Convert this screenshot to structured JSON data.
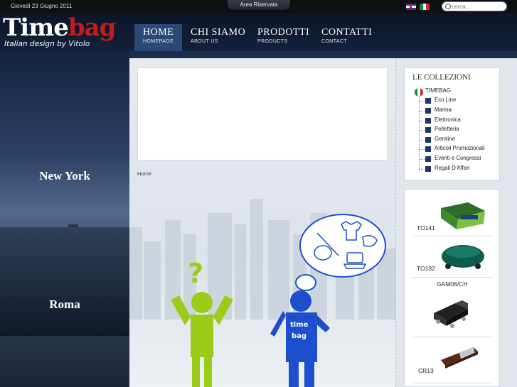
{
  "topbar": {
    "date": "Giovedì 23 Giugno 2011",
    "area_label": "Area Riservata",
    "search_placeholder": "cerca..."
  },
  "logo": {
    "brand_part1": "Time",
    "brand_part2": "bag",
    "tagline": "Italian design by Vitolo"
  },
  "nav": [
    {
      "label": "HOME",
      "sub": "HOMEPAGE",
      "active": true
    },
    {
      "label": "CHI SIAMO",
      "sub": "ABOUT US",
      "active": false
    },
    {
      "label": "PRODOTTI",
      "sub": "PRODUCTS",
      "active": false
    },
    {
      "label": "CONTATTI",
      "sub": "CONTACT",
      "active": false
    }
  ],
  "cities": {
    "top": "New York",
    "bottom": "Roma"
  },
  "breadcrumb": "Home",
  "illustration": {
    "shirt_text_1": "time",
    "shirt_text_2": "bag"
  },
  "collections": {
    "title": "LE COLLEZIONI",
    "root": "TIMEBAG",
    "items": [
      "Eco Line",
      "Marina",
      "Elettronica",
      "Pelletteria",
      "Gemline",
      "Articoli Promozionali",
      "Eventi e Congressi",
      "Regali D'Affari"
    ]
  },
  "products": [
    {
      "code": "TO141"
    },
    {
      "code": "TO132"
    },
    {
      "code": "GAM06/CH"
    },
    {
      "code": "CR13"
    }
  ],
  "colors": {
    "accent_nav": "#2b4876",
    "brand_red": "#c21d1d",
    "figure_green": "#9ccc1a",
    "figure_blue": "#1d4fcc",
    "tree_square": "#1e3768"
  }
}
